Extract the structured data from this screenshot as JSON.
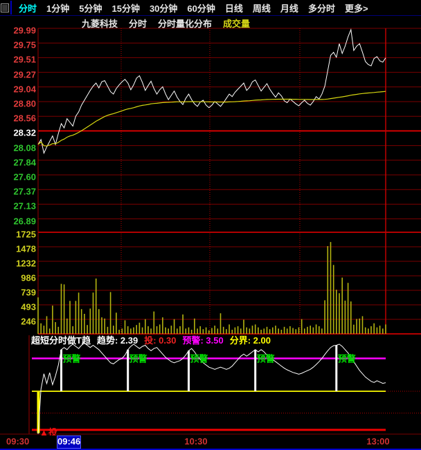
{
  "menu": {
    "items": [
      {
        "label": "分时",
        "active": true
      },
      {
        "label": "1分钟",
        "active": false
      },
      {
        "label": "5分钟",
        "active": false
      },
      {
        "label": "15分钟",
        "active": false
      },
      {
        "label": "30分钟",
        "active": false
      },
      {
        "label": "60分钟",
        "active": false
      },
      {
        "label": "日线",
        "active": false
      },
      {
        "label": "周线",
        "active": false
      },
      {
        "label": "月线",
        "active": false
      },
      {
        "label": "多分时",
        "active": false
      },
      {
        "label": "更多>",
        "active": false
      }
    ]
  },
  "header": {
    "stock_name": "九菱科技",
    "period_label": "分时",
    "study_label": "分时量化分布",
    "volume_label": "成交量"
  },
  "price_axis": {
    "labels": [
      {
        "text": "29.99",
        "color": "red"
      },
      {
        "text": "29.75",
        "color": "red"
      },
      {
        "text": "29.51",
        "color": "red"
      },
      {
        "text": "29.27",
        "color": "red"
      },
      {
        "text": "29.04",
        "color": "red"
      },
      {
        "text": "28.80",
        "color": "red"
      },
      {
        "text": "28.56",
        "color": "red"
      },
      {
        "text": "28.32",
        "color": "white"
      },
      {
        "text": "28.08",
        "color": "green"
      },
      {
        "text": "27.84",
        "color": "green"
      },
      {
        "text": "27.60",
        "color": "green"
      },
      {
        "text": "27.37",
        "color": "green"
      },
      {
        "text": "27.13",
        "color": "green"
      },
      {
        "text": "26.89",
        "color": "green"
      }
    ]
  },
  "volume_axis": {
    "labels": [
      "1725",
      "1478",
      "1232",
      "986",
      "739",
      "493",
      "246"
    ]
  },
  "indicator_header": {
    "name": "超短分时做T趋",
    "fields": [
      {
        "label": "趋势",
        "value": "2.39",
        "color": "#ffffff"
      },
      {
        "label": "投",
        "value": "0.30",
        "color": "#ee2222"
      },
      {
        "label": "预警",
        "value": "3.50",
        "color": "#ff00ff"
      },
      {
        "label": "分界",
        "value": "2.00",
        "color": "#ffff00"
      }
    ]
  },
  "time_axis": {
    "start_label": "09:30",
    "highlight_label": "09:46",
    "mid_label": "10:30",
    "end_label": "13:00"
  },
  "chart_data": {
    "type": "line",
    "title": "九菱科技 分时",
    "price_scale": {
      "max": 29.99,
      "min": 26.89,
      "prev_close": 28.32,
      "gridlines": 14
    },
    "volume_scale": {
      "max": 1725,
      "step": 246
    },
    "price_series": [
      28.1,
      28.18,
      27.96,
      28.06,
      28.15,
      28.24,
      28.1,
      28.28,
      28.44,
      28.37,
      28.52,
      28.46,
      28.4,
      28.56,
      28.63,
      28.74,
      28.82,
      28.9,
      28.98,
      29.05,
      29.1,
      29.02,
      29.12,
      29.14,
      29.05,
      28.96,
      28.92,
      29.01,
      29.07,
      29.12,
      29.16,
      29.1,
      28.99,
      29.07,
      29.18,
      29.22,
      29.11,
      28.98,
      29.06,
      29.13,
      29.01,
      28.92,
      28.99,
      29.04,
      28.92,
      28.83,
      28.9,
      28.97,
      28.87,
      28.8,
      28.75,
      28.85,
      28.92,
      28.83,
      28.76,
      28.72,
      28.79,
      28.82,
      28.74,
      28.7,
      28.74,
      28.8,
      28.76,
      28.72,
      28.78,
      28.85,
      28.92,
      28.88,
      28.95,
      29.0,
      29.05,
      29.1,
      28.98,
      29.03,
      29.12,
      29.15,
      29.06,
      28.97,
      29.03,
      29.09,
      29.0,
      28.93,
      28.87,
      28.94,
      28.89,
      28.81,
      28.78,
      28.84,
      28.8,
      28.76,
      28.73,
      28.78,
      28.82,
      28.77,
      28.74,
      28.8,
      28.88,
      28.84,
      28.92,
      29.05,
      29.3,
      29.55,
      29.6,
      29.52,
      29.74,
      29.58,
      29.7,
      29.85,
      29.97,
      29.63,
      29.7,
      29.74,
      29.6,
      29.45,
      29.4,
      29.38,
      29.5,
      29.53,
      29.46,
      29.44,
      29.51
    ],
    "volume_series": [
      620,
      180,
      140,
      300,
      90,
      480,
      200,
      120,
      850,
      840,
      260,
      560,
      130,
      560,
      700,
      420,
      340,
      150,
      430,
      700,
      940,
      420,
      280,
      260,
      120,
      710,
      140,
      360,
      70,
      90,
      230,
      130,
      90,
      110,
      150,
      190,
      110,
      250,
      130,
      90,
      380,
      130,
      160,
      280,
      110,
      90,
      140,
      250,
      90,
      130,
      330,
      90,
      110,
      70,
      260,
      90,
      130,
      80,
      110,
      60,
      100,
      140,
      90,
      350,
      120,
      80,
      160,
      70,
      110,
      130,
      90,
      240,
      110,
      90,
      140,
      160,
      110,
      70,
      90,
      120,
      80,
      110,
      140,
      90,
      70,
      120,
      90,
      130,
      100,
      80,
      110,
      250,
      90,
      120,
      140,
      110,
      160,
      130,
      90,
      570,
      1490,
      1560,
      1170,
      750,
      690,
      955,
      565,
      866,
      550,
      156,
      253,
      260,
      300,
      110,
      90,
      130,
      180,
      110,
      140,
      90,
      160
    ],
    "indicator": {
      "name": "超短分时做T趋",
      "current_value": 2.39,
      "alarm_level": 3.5,
      "boundary_level": 2.0,
      "buy_level": 0.3,
      "dotted_level": 1.0,
      "alarm_text": "预警",
      "buy_marker": "▲",
      "buy_text": "投",
      "signal_minutes": [
        8,
        31,
        52,
        75,
        103
      ],
      "series": [
        0.05,
        2.1,
        2.8,
        2.35,
        2.85,
        2.3,
        2.7,
        3.2,
        3.9,
        4.0,
        3.9,
        4.05,
        4.15,
        4.05,
        3.95,
        4.1,
        4.2,
        4.1,
        4.0,
        4.1,
        4.0,
        3.9,
        3.75,
        3.6,
        3.45,
        3.3,
        3.25,
        3.35,
        3.45,
        3.5,
        3.65,
        3.9,
        4.05,
        4.15,
        4.05,
        3.95,
        4.05,
        4.1,
        3.95,
        3.85,
        3.95,
        4.0,
        3.85,
        3.7,
        3.55,
        3.45,
        3.35,
        3.3,
        3.35,
        3.4,
        3.5,
        3.65,
        3.85,
        3.95,
        3.8,
        3.6,
        3.45,
        3.3,
        3.2,
        3.1,
        3.05,
        3.0,
        3.05,
        3.1,
        3.05,
        3.0,
        3.05,
        3.15,
        3.3,
        3.45,
        3.6,
        3.7,
        3.6,
        3.7,
        3.8,
        3.9,
        3.8,
        3.9,
        3.8,
        3.65,
        3.55,
        3.45,
        3.35,
        3.25,
        3.15,
        3.05,
        2.98,
        2.92,
        2.86,
        2.82,
        2.78,
        2.82,
        2.88,
        2.94,
        3.0,
        3.1,
        3.22,
        3.35,
        3.5,
        3.68,
        3.85,
        4.0,
        4.08,
        4.1,
        4.15,
        4.05,
        3.9,
        3.75,
        3.55,
        3.35,
        3.15,
        2.95,
        2.8,
        2.65,
        2.55,
        2.45,
        2.4,
        2.48,
        2.42,
        2.36,
        2.39
      ]
    },
    "colors": {
      "grid_dark": "#7c0000",
      "grid_bright": "#d40000",
      "price_line": "#ffffff",
      "avg_line": "#d8d810",
      "volume_bar": "#b4b410",
      "alarm_line": "#ff00ff",
      "boundary_line": "#ffff00",
      "buy_line": "#ee0000",
      "signal_bar": "#ffffff",
      "start_bar": "#ffff00"
    }
  }
}
